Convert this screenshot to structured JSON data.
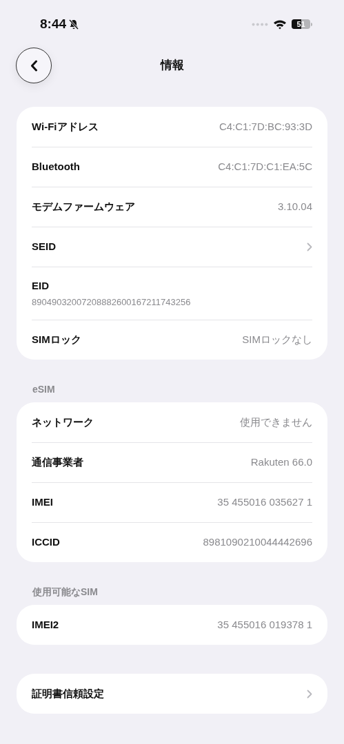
{
  "status_bar": {
    "time": "8:44",
    "battery": "51"
  },
  "nav": {
    "title": "情報"
  },
  "sections": [
    {
      "rows": [
        {
          "kind": "value",
          "label": "Wi-Fiアドレス",
          "value": "C4:C1:7D:BC:93:3D"
        },
        {
          "kind": "value",
          "label": "Bluetooth",
          "value": "C4:C1:7D:C1:EA:5C"
        },
        {
          "kind": "value",
          "label": "モデムファームウェア",
          "value": "3.10.04"
        },
        {
          "kind": "link",
          "label": "SEID"
        },
        {
          "kind": "stacked",
          "label": "EID",
          "value": "89049032007208882600167211743256"
        },
        {
          "kind": "value",
          "label": "SIMロック",
          "value": "SIMロックなし"
        }
      ]
    },
    {
      "header": "eSIM",
      "rows": [
        {
          "kind": "value",
          "label": "ネットワーク",
          "value": "使用できません"
        },
        {
          "kind": "value",
          "label": "通信事業者",
          "value": "Rakuten 66.0"
        },
        {
          "kind": "value",
          "label": "IMEI",
          "value": "35 455016 035627 1"
        },
        {
          "kind": "value",
          "label": "ICCID",
          "value": "8981090210044442696"
        }
      ]
    },
    {
      "header": "使用可能なSIM",
      "rows": [
        {
          "kind": "value",
          "label": "IMEI2",
          "value": "35 455016 019378 1"
        }
      ]
    },
    {
      "rows": [
        {
          "kind": "link",
          "label": "証明書信頼設定"
        }
      ]
    }
  ]
}
